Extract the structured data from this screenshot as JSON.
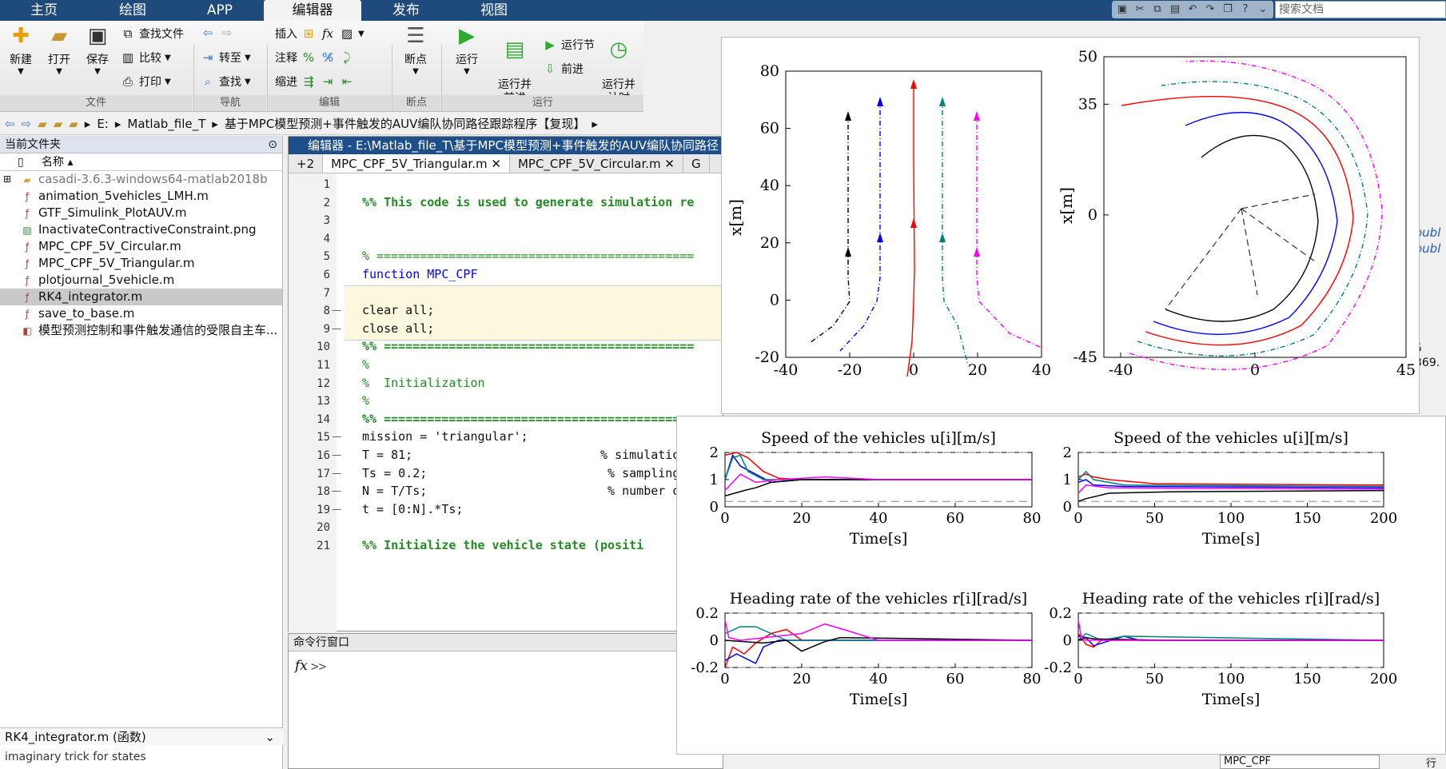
{
  "ribbon_tabs": [
    "主页",
    "绘图",
    "APP",
    "编辑器",
    "发布",
    "视图"
  ],
  "search_placeholder": "搜索文档",
  "ribbon": {
    "new": "新建",
    "open": "打开",
    "save": "保存",
    "find_files": "查找文件",
    "compare": "比较",
    "print": "打印",
    "goto": "转至",
    "find": "查找",
    "insert": "插入",
    "comment": "注释",
    "indent": "缩进",
    "breakpoints": "断点",
    "run": "运行",
    "run_advance": "运行并\n前进",
    "run_section": "运行节",
    "advance": "前进",
    "run_time": "运行并\n计时",
    "groups": [
      "文件",
      "导航",
      "编辑",
      "断点",
      "运行"
    ]
  },
  "address": {
    "parts": [
      "E:",
      "Matlab_file_T",
      "基于MPC模型预测+事件触发的AUV编队协同路径跟踪程序【复现】"
    ]
  },
  "file_panel": {
    "title": "当前文件夹",
    "col_name": "名称 ▴",
    "files": [
      {
        "name": "casadi-3.6.3-windows64-matlab2018b",
        "icon": "folder"
      },
      {
        "name": "animation_5vehicles_LMH.m",
        "icon": "mfile"
      },
      {
        "name": "GTF_Simulink_PlotAUV.m",
        "icon": "mfile"
      },
      {
        "name": "InactivateContractiveConstraint.png",
        "icon": "image"
      },
      {
        "name": "MPC_CPF_5V_Circular.m",
        "icon": "mfile"
      },
      {
        "name": "MPC_CPF_5V_Triangular.m",
        "icon": "mfile"
      },
      {
        "name": "plotjournal_5vehicle.m",
        "icon": "mfile"
      },
      {
        "name": "RK4_integrator.m",
        "icon": "mfile"
      },
      {
        "name": "save_to_base.m",
        "icon": "mfile"
      },
      {
        "name": "模型预测控制和事件触发通信的受限自主车...",
        "icon": "pdf"
      }
    ],
    "status": "RK4_integrator.m  (函数)",
    "tail": "imaginary trick for states"
  },
  "editor": {
    "title": "编辑器 - E:\\Matlab_file_T\\基于MPC模型预测+事件触发的AUV编队协同路径",
    "tab_count": "+2",
    "tabs": [
      "MPC_CPF_5V_Triangular.m",
      "MPC_CPF_5V_Circular.m",
      "G"
    ],
    "lines": [
      {
        "n": "1",
        "t": ""
      },
      {
        "n": "2",
        "t": "%% This code is used to generate simulation re"
      },
      {
        "n": "3",
        "t": ""
      },
      {
        "n": "4",
        "t": ""
      },
      {
        "n": "5",
        "t": "% ============================================"
      },
      {
        "n": "6",
        "t": "function MPC_CPF"
      },
      {
        "n": "7",
        "t": ""
      },
      {
        "n": "8",
        "t": "clear all;"
      },
      {
        "n": "9",
        "t": "close all;"
      },
      {
        "n": "10",
        "t": "%% ==========================================="
      },
      {
        "n": "11",
        "t": "%"
      },
      {
        "n": "12",
        "t": "%  Initialization"
      },
      {
        "n": "13",
        "t": "%"
      },
      {
        "n": "14",
        "t": "%% ==========================================="
      },
      {
        "n": "15",
        "t": "mission = 'triangular';"
      },
      {
        "n": "16",
        "t": "T = 81;                          % simulation"
      },
      {
        "n": "17",
        "t": "Ts = 0.2;                         % sampling"
      },
      {
        "n": "18",
        "t": "N = T/Ts;                         % number of"
      },
      {
        "n": "19",
        "t": "t = [0:N].*Ts;"
      },
      {
        "n": "20",
        "t": ""
      },
      {
        "n": "21",
        "t": "%% Initialize the vehicle state (positi"
      }
    ]
  },
  "command_window": {
    "title": "命令行窗口",
    "prompt": ">>"
  },
  "right_fragments": {
    "a": "oubl",
    "b": "oubl",
    "c": "5",
    "d": "369.",
    "e": "MPC_CPF",
    "f": "行"
  },
  "chart_data": [
    {
      "type": "line",
      "title": "",
      "xlabel": "",
      "ylabel": "x[m]",
      "xlim": [
        -40,
        40
      ],
      "ylim": [
        -20,
        80
      ],
      "xticks": [
        -40,
        -20,
        0,
        20,
        40
      ],
      "yticks": [
        -20,
        0,
        20,
        40,
        60,
        80
      ]
    },
    {
      "type": "line",
      "title": "",
      "xlabel": "",
      "ylabel": "x[m]",
      "xlim": [
        -45,
        45
      ],
      "ylim": [
        -45,
        50
      ],
      "xticks": [
        -40,
        0,
        45
      ],
      "yticks": [
        -45,
        0,
        35,
        50
      ]
    },
    {
      "type": "line",
      "title": "Speed of the vehicles u[i][m/s]",
      "xlabel": "Time[s]",
      "ylabel": "",
      "xlim": [
        0,
        80
      ],
      "ylim": [
        0,
        2
      ],
      "xticks": [
        0,
        20,
        40,
        60,
        80
      ],
      "yticks": [
        0,
        1,
        2
      ],
      "series": [
        {
          "color": "#ff0000",
          "x": [
            0,
            3,
            6,
            10,
            14,
            20,
            30,
            80
          ],
          "y": [
            1.9,
            2.0,
            1.8,
            1.3,
            1.05,
            1.0,
            1.0,
            1.0
          ]
        },
        {
          "color": "#0000ff",
          "x": [
            0,
            2,
            4,
            8,
            12,
            20,
            40,
            80
          ],
          "y": [
            1.0,
            1.9,
            1.5,
            1.2,
            0.9,
            1.0,
            1.0,
            1.0
          ]
        },
        {
          "color": "#008080",
          "x": [
            0,
            2,
            4,
            6,
            10,
            20,
            40,
            80
          ],
          "y": [
            1.0,
            1.8,
            1.9,
            1.3,
            1.0,
            1.0,
            1.0,
            1.0
          ]
        },
        {
          "color": "#000000",
          "x": [
            0,
            5,
            8,
            12,
            20,
            30,
            80
          ],
          "y": [
            0.4,
            0.6,
            0.7,
            0.9,
            1.0,
            1.0,
            1.0
          ]
        },
        {
          "color": "#ff00ff",
          "x": [
            0,
            4,
            8,
            14,
            26,
            40,
            80
          ],
          "y": [
            0.6,
            1.2,
            0.9,
            1.0,
            1.1,
            1.0,
            1.0
          ]
        }
      ]
    },
    {
      "type": "line",
      "title": "Speed of the vehicles u[i][m/s]",
      "xlabel": "Time[s]",
      "ylabel": "",
      "xlim": [
        0,
        200
      ],
      "ylim": [
        0,
        2
      ],
      "xticks": [
        0,
        50,
        100,
        150,
        200
      ],
      "yticks": [
        0,
        1,
        2
      ],
      "series": [
        {
          "color": "#ff0000",
          "x": [
            0,
            5,
            10,
            20,
            50,
            200
          ],
          "y": [
            1.1,
            1.2,
            1.1,
            1.0,
            0.85,
            0.8
          ]
        },
        {
          "color": "#0000ff",
          "x": [
            0,
            5,
            10,
            30,
            200
          ],
          "y": [
            0.9,
            1.0,
            0.8,
            0.75,
            0.7
          ]
        },
        {
          "color": "#008080",
          "x": [
            0,
            5,
            10,
            30,
            200
          ],
          "y": [
            1.0,
            1.3,
            1.0,
            0.8,
            0.75
          ]
        },
        {
          "color": "#000000",
          "x": [
            0,
            5,
            20,
            60,
            200
          ],
          "y": [
            0.2,
            0.3,
            0.5,
            0.55,
            0.6
          ]
        },
        {
          "color": "#ff00ff",
          "x": [
            0,
            5,
            20,
            60,
            200
          ],
          "y": [
            0.5,
            0.8,
            0.7,
            0.68,
            0.65
          ]
        }
      ]
    },
    {
      "type": "line",
      "title": "Heading rate of the vehicles r[i][rad/s]",
      "xlabel": "Time[s]",
      "ylabel": "",
      "xlim": [
        0,
        80
      ],
      "ylim": [
        -0.2,
        0.2
      ],
      "xticks": [
        0,
        20,
        40,
        60,
        80
      ],
      "yticks": [
        -0.2,
        0,
        0.2
      ],
      "series": [
        {
          "color": "#ff0000",
          "x": [
            0,
            2,
            5,
            8,
            12,
            16,
            20,
            30,
            80
          ],
          "y": [
            -0.2,
            -0.05,
            -0.1,
            -0.02,
            0.05,
            0.08,
            0.0,
            0.0,
            0.0
          ]
        },
        {
          "color": "#0000ff",
          "x": [
            0,
            3,
            8,
            10,
            14,
            20,
            80
          ],
          "y": [
            -0.15,
            -0.1,
            -0.17,
            -0.05,
            0.0,
            0.0,
            0.0
          ]
        },
        {
          "color": "#008080",
          "x": [
            0,
            4,
            8,
            12,
            16,
            20,
            80
          ],
          "y": [
            0.05,
            0.1,
            0.1,
            0.05,
            0.0,
            0.0,
            0.0
          ]
        },
        {
          "color": "#000000",
          "x": [
            0,
            10,
            16,
            20,
            26,
            30,
            80
          ],
          "y": [
            0.0,
            -0.02,
            0.0,
            -0.08,
            -0.01,
            0.02,
            0.0
          ]
        },
        {
          "color": "#ff00ff",
          "x": [
            0,
            1,
            4,
            20,
            26,
            32,
            40,
            80
          ],
          "y": [
            0.15,
            0.02,
            0.0,
            0.05,
            0.12,
            0.07,
            0.0,
            0.0
          ]
        }
      ]
    },
    {
      "type": "line",
      "title": "Heading rate of the vehicles r[i][rad/s]",
      "xlabel": "Time[s]",
      "ylabel": "",
      "xlim": [
        0,
        200
      ],
      "ylim": [
        -0.2,
        0.2
      ],
      "xticks": [
        0,
        50,
        100,
        150,
        200
      ],
      "yticks": [
        -0.2,
        0,
        0.2
      ],
      "series": [
        {
          "color": "#ff0000",
          "x": [
            0,
            5,
            10,
            15,
            20,
            200
          ],
          "y": [
            0.05,
            -0.03,
            -0.05,
            0.0,
            0.0,
            0.0
          ]
        },
        {
          "color": "#0000ff",
          "x": [
            0,
            5,
            10,
            30,
            40,
            200
          ],
          "y": [
            0.03,
            0.02,
            -0.04,
            0.03,
            0.0,
            0.0
          ]
        },
        {
          "color": "#008080",
          "x": [
            0,
            5,
            15,
            30,
            200
          ],
          "y": [
            0.0,
            0.05,
            0.0,
            0.03,
            0.0
          ]
        },
        {
          "color": "#000000",
          "x": [
            0,
            5,
            10,
            60,
            200
          ],
          "y": [
            0.0,
            0.02,
            0.01,
            0.0,
            0.0
          ]
        },
        {
          "color": "#ff00ff",
          "x": [
            0,
            2,
            5,
            20,
            200
          ],
          "y": [
            0.15,
            0.02,
            0.0,
            0.0,
            0.0
          ]
        }
      ]
    }
  ]
}
